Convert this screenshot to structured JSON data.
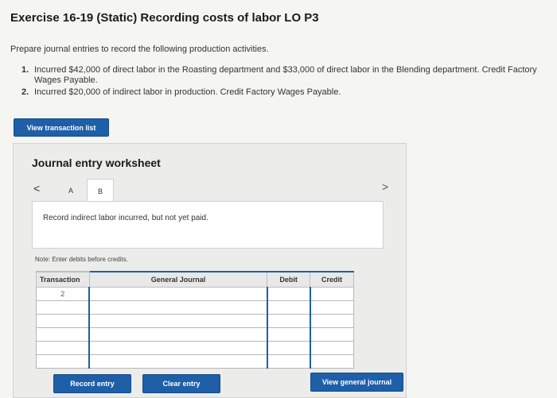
{
  "exercise": {
    "title": "Exercise 16-19 (Static) Recording costs of labor LO P3",
    "instructions": "Prepare journal entries to record the following production activities.",
    "items": [
      {
        "number": "1.",
        "text": "Incurred $42,000 of direct labor in the Roasting department and $33,000 of direct labor in the Blending department. Credit Factory Wages Payable."
      },
      {
        "number": "2.",
        "text": "Incurred $20,000 of indirect labor in production. Credit Factory Wages Payable."
      }
    ]
  },
  "view_transaction_label": "View transaction list",
  "worksheet": {
    "title": "Journal entry worksheet",
    "nav_prev": "<",
    "nav_next": ">",
    "tabs": [
      {
        "label": "A"
      },
      {
        "label": "B"
      }
    ],
    "active_tab": "B",
    "description": "Record indirect labor incurred, but not yet paid.",
    "note": "Note: Enter debits before credits."
  },
  "journal_table": {
    "headers": {
      "transaction": "Transaction",
      "general_journal": "General Journal",
      "debit": "Debit",
      "credit": "Credit"
    },
    "rows": [
      {
        "transaction": "2",
        "account": "",
        "debit": "",
        "credit": ""
      },
      {
        "transaction": "",
        "account": "",
        "debit": "",
        "credit": ""
      },
      {
        "transaction": "",
        "account": "",
        "debit": "",
        "credit": ""
      },
      {
        "transaction": "",
        "account": "",
        "debit": "",
        "credit": ""
      },
      {
        "transaction": "",
        "account": "",
        "debit": "",
        "credit": ""
      },
      {
        "transaction": "",
        "account": "",
        "debit": "",
        "credit": ""
      }
    ]
  },
  "buttons": {
    "record_entry": "Record entry",
    "clear_entry": "Clear entry",
    "view_general_journal": "View general journal"
  },
  "colors": {
    "accent": "#1e5fa8",
    "background": "#f5f5f3",
    "worksheet_bg": "#ececea"
  }
}
